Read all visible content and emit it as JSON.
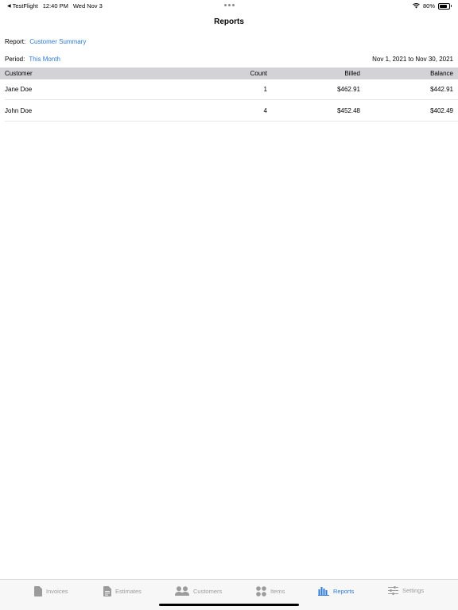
{
  "status_bar": {
    "back_app": "TestFlight",
    "time": "12:40 PM",
    "date": "Wed Nov 3",
    "battery": "80%",
    "battery_level": 0.8
  },
  "nav": {
    "title": "Reports"
  },
  "filters": {
    "report_label": "Report:",
    "report_value": "Customer Summary",
    "period_label": "Period:",
    "period_value": "This Month",
    "date_range": "Nov 1, 2021 to Nov 30, 2021"
  },
  "table": {
    "columns": [
      "Customer",
      "Count",
      "Billed",
      "Balance"
    ],
    "rows": [
      [
        "Jane Doe",
        "1",
        "$462.91",
        "$442.91"
      ],
      [
        "John Doe",
        "4",
        "$452.48",
        "$402.49"
      ]
    ]
  },
  "tab_bar": {
    "items": [
      {
        "label": "Invoices",
        "icon": "document-icon"
      },
      {
        "label": "Estimates",
        "icon": "document-lines-icon"
      },
      {
        "label": "Customers",
        "icon": "people-icon"
      },
      {
        "label": "Items",
        "icon": "four-circles-icon"
      },
      {
        "label": "Reports",
        "icon": "bar-chart-icon"
      },
      {
        "label": "Settings",
        "icon": "sliders-icon"
      }
    ],
    "active": "Reports"
  },
  "colors": {
    "accent": "#2f7bd3",
    "inactive": "#9b9b9b",
    "header_bg": "#d2d2d7"
  }
}
